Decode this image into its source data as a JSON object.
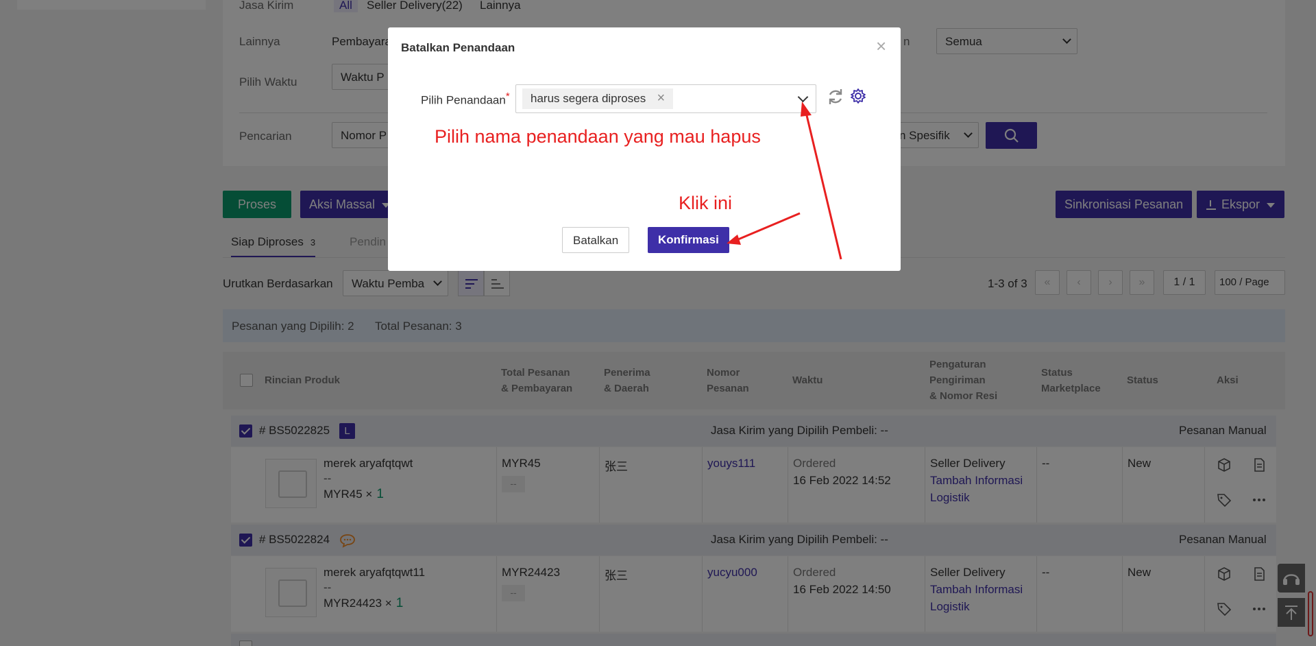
{
  "filters": {
    "jasa_kirim_label": "Jasa Kirim",
    "jasa_kirim_options": [
      "All",
      "Seller Delivery(22)",
      "Lainnya"
    ],
    "lainnya_label": "Lainnya",
    "lainnya_value": "Pembayaran",
    "semua_select": "Semua",
    "pilih_waktu_label": "Pilih Waktu",
    "waktu_select": "Waktu P",
    "pencarian_label": "Pencarian",
    "pencarian_select": "Nomor P",
    "pencarian_mode": "n Spesifik",
    "partial_label_right": "n"
  },
  "toolbar": {
    "proses": "Proses",
    "aksi_massal": "Aksi Massal",
    "sinkronisasi": "Sinkronisasi Pesanan",
    "ekspor": "Ekspor"
  },
  "tabs": [
    {
      "label": "Siap Diproses",
      "count": "3"
    },
    {
      "label": "Pendin",
      "count": ""
    }
  ],
  "sort": {
    "label": "Urutkan Berdasarkan",
    "value": "Waktu Pemba"
  },
  "pagination": {
    "range": "1-3 of 3",
    "page": "1 / 1",
    "per_page": "100 / Page"
  },
  "selection": {
    "selected": "Pesanan yang Dipilih: 2",
    "total": "Total Pesanan: 3"
  },
  "columns": {
    "produk": "Rincian Produk",
    "total_a": "Total Pesanan",
    "total_b": "& Pembayaran",
    "penerima_a": "Penerima",
    "penerima_b": "& Daerah",
    "nomor_a": "Nomor",
    "nomor_b": "Pesanan",
    "waktu": "Waktu",
    "pengaturan_a": "Pengaturan",
    "pengaturan_b": "Pengiriman",
    "pengaturan_c": "& Nomor Resi",
    "status_mp_a": "Status",
    "status_mp_b": "Marketplace",
    "status": "Status",
    "aksi": "Aksi"
  },
  "orders": [
    {
      "id": "# BS5022825",
      "tag": "L",
      "buyer_shipping": "Jasa Kirim yang Dipilih Pembeli: --",
      "type": "Pesanan Manual",
      "product_name": "merek aryafqtqwt",
      "product_variant": "--",
      "product_price": "MYR45",
      "qty_sign": "×",
      "qty": "1",
      "total": "MYR45",
      "payment": "--",
      "recipient": "张三",
      "order_no": "youys111",
      "time_status": "Ordered",
      "time": "16 Feb 2022 14:52",
      "shipping": "Seller Delivery",
      "add_logistics_a": "Tambah Informasi",
      "add_logistics_b": "Logistik",
      "mp_status": "--",
      "status": "New"
    },
    {
      "id": "# BS5022824",
      "tag": "",
      "buyer_shipping": "Jasa Kirim yang Dipilih Pembeli: --",
      "type": "Pesanan Manual",
      "product_name": "merek aryafqtqwt11",
      "product_variant": "--",
      "product_price": "MYR24423",
      "qty_sign": "×",
      "qty": "1",
      "total": "MYR24423",
      "payment": "--",
      "recipient": "张三",
      "order_no": "yucyu000",
      "time_status": "Ordered",
      "time": "16 Feb 2022 14:50",
      "shipping": "Seller Delivery",
      "add_logistics_a": "Tambah Informasi",
      "add_logistics_b": "Logistik",
      "mp_status": "--",
      "status": "New"
    }
  ],
  "modal": {
    "title": "Batalkan Penandaan",
    "close": "×",
    "field_label": "Pilih Penandaan",
    "required_mark": "*",
    "selected_tag": "harus segera diproses",
    "tag_remove": "×",
    "cancel": "Batalkan",
    "confirm": "Konfirmasi"
  },
  "annotations": {
    "hint": "Pilih nama penandaan yang mau hapus",
    "click": "Klik ini"
  },
  "colors": {
    "primary": "#3e2fa8",
    "green": "#0a9b6c",
    "annotation": "#e82020"
  }
}
